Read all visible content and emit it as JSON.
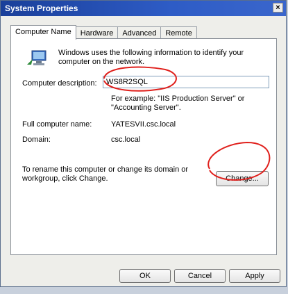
{
  "window": {
    "title": "System Properties",
    "close_glyph": "×"
  },
  "tabs": [
    {
      "label": "Computer Name",
      "active": true
    },
    {
      "label": "Hardware",
      "active": false
    },
    {
      "label": "Advanced",
      "active": false
    },
    {
      "label": "Remote",
      "active": false
    }
  ],
  "panel": {
    "icon": "computer-network-icon",
    "intro": "Windows uses the following information to identify your computer on the network.",
    "description_label": "Computer description:",
    "description_value": "WS8R2SQL",
    "example": "For example: \"IIS Production Server\" or \"Accounting Server\".",
    "full_name_label": "Full computer name:",
    "full_name_value": "YATESVII.csc.local",
    "domain_label": "Domain:",
    "domain_value": "csc.local",
    "rename_text": "To rename this computer or change its domain or workgroup, click Change.",
    "change_label": "Change..."
  },
  "footer": {
    "ok_label": "OK",
    "cancel_label": "Cancel",
    "apply_label": "Apply"
  },
  "colors": {
    "annotation": "#e0201c",
    "titlebar": "#2652b8"
  }
}
